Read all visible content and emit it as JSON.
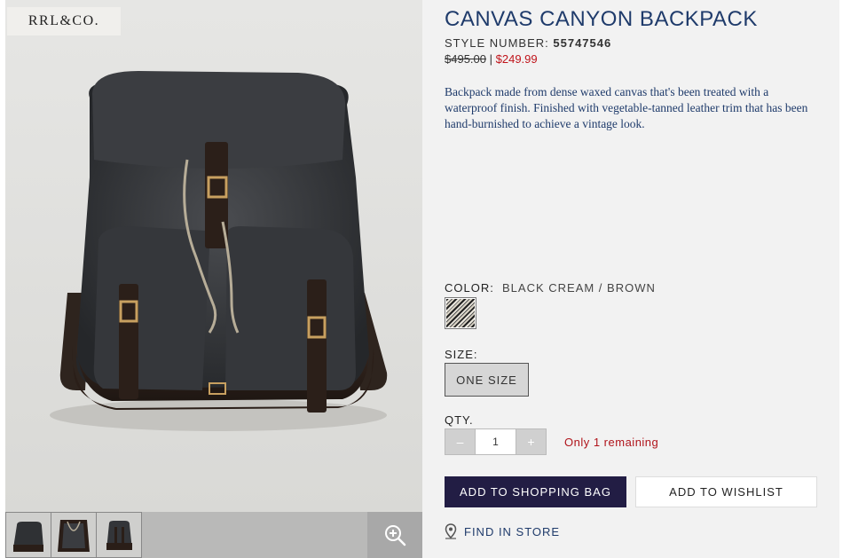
{
  "brand": {
    "logo_text": "RRL&CO."
  },
  "product": {
    "title": "CANVAS CANYON BACKPACK",
    "style_label": "STYLE NUMBER:",
    "style_number": "55747546",
    "original_price": "$495.00",
    "price_separator": "|",
    "sale_price": "$249.99",
    "description": "Backpack made from dense waxed canvas that's been treated with a waterproof finish. Finished with vegetable-tanned leather trim that has been hand-burnished to achieve a vintage look."
  },
  "options": {
    "color_label": "COLOR:",
    "color_value": "BLACK CREAM / BROWN",
    "size_label": "SIZE:",
    "size_value": "ONE SIZE",
    "qty_label": "QTY.",
    "qty_value": "1",
    "qty_minus": "–",
    "qty_plus": "+",
    "stock_message": "Only 1 remaining"
  },
  "actions": {
    "add_to_bag": "ADD TO SHOPPING BAG",
    "add_to_wishlist": "ADD TO WISHLIST",
    "find_in_store": "FIND IN STORE"
  },
  "gallery": {
    "thumbnails": [
      "backpack-front",
      "backpack-open",
      "backpack-back"
    ],
    "zoom_icon": "zoom-in-icon"
  },
  "colors": {
    "accent_blue": "#1f3b6b",
    "sale_red": "#c0141b",
    "bag_button": "#221d44"
  }
}
